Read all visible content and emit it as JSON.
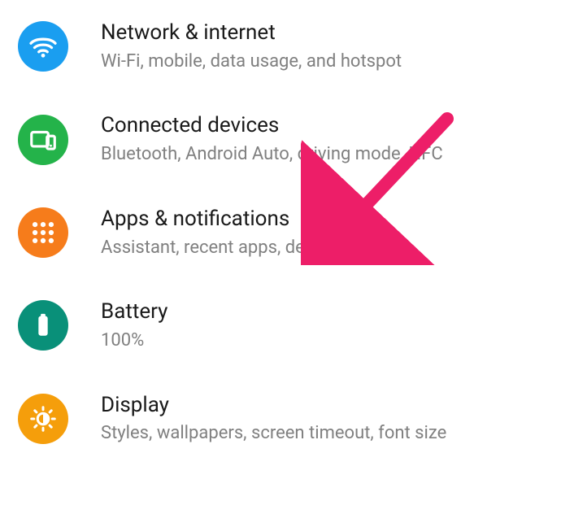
{
  "settings": [
    {
      "id": "network",
      "title": "Network & internet",
      "subtitle": "Wi-Fi, mobile, data usage, and hotspot",
      "icon": "wifi-icon",
      "color": "#1a9ef0"
    },
    {
      "id": "connected",
      "title": "Connected devices",
      "subtitle": "Bluetooth, Android Auto, driving mode, NFC",
      "icon": "devices-icon",
      "color": "#24b34a"
    },
    {
      "id": "apps",
      "title": "Apps & notifications",
      "subtitle": "Assistant, recent apps, default apps",
      "icon": "apps-icon",
      "color": "#f67c1b"
    },
    {
      "id": "battery",
      "title": "Battery",
      "subtitle": "100%",
      "icon": "battery-icon",
      "color": "#099079"
    },
    {
      "id": "display",
      "title": "Display",
      "subtitle": "Styles, wallpapers, screen timeout, font size",
      "icon": "display-icon",
      "color": "#f59e0b"
    }
  ],
  "annotation": {
    "target": "apps",
    "color": "#ed1e68"
  }
}
